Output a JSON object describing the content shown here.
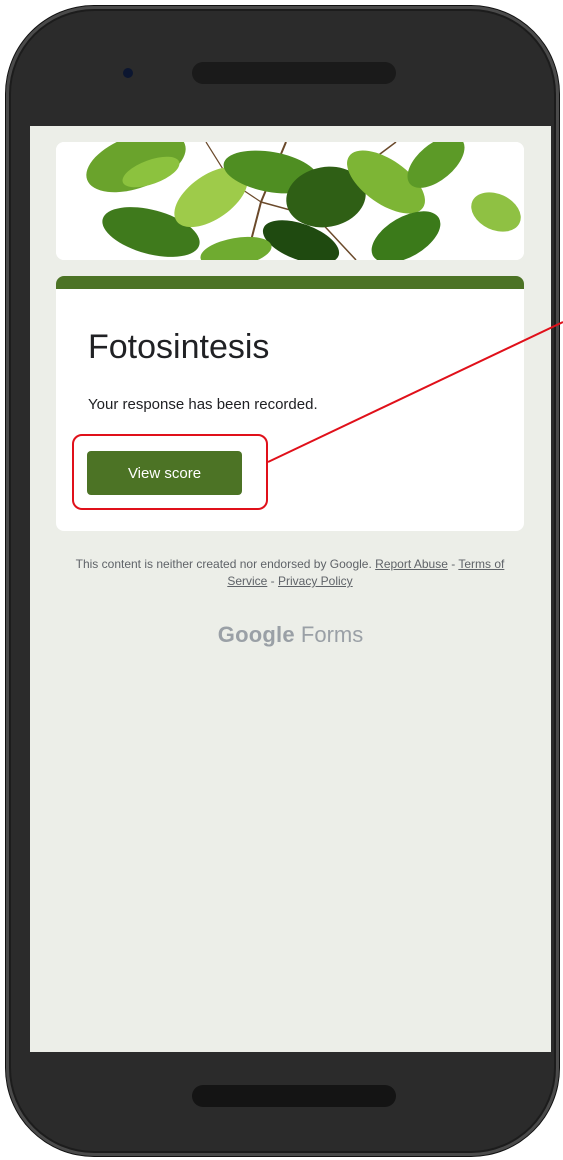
{
  "form": {
    "title": "Fotosintesis",
    "confirmation_message": "Your response has been recorded.",
    "view_score_label": "View score",
    "accent_color": "#4c7325",
    "background_color": "#eceee8"
  },
  "footer": {
    "disclaimer": "This content is neither created nor endorsed by Google.",
    "report_abuse": "Report Abuse",
    "separator": " - ",
    "terms": "Terms of Service",
    "privacy": "Privacy Policy"
  },
  "brand": {
    "google": "Google",
    "forms": "Forms"
  },
  "icons": {
    "header_image": "green-leaves-banner"
  },
  "annotation": {
    "color": "#e0101a"
  }
}
